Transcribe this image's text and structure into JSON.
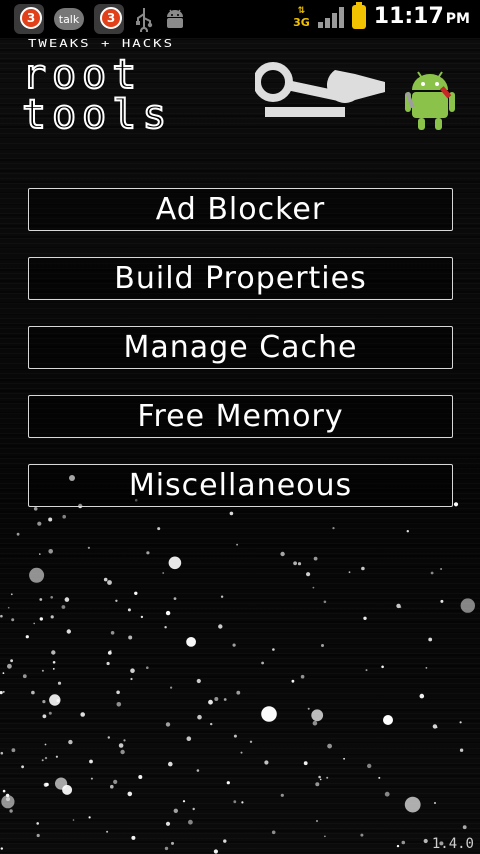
{
  "status_bar": {
    "notifications": [
      {
        "icon": "gmail-icon",
        "count": "3"
      },
      {
        "icon": "talk-icon",
        "label": "talk"
      },
      {
        "icon": "message-icon",
        "count": "3"
      },
      {
        "icon": "usb-icon"
      },
      {
        "icon": "android-debug-icon"
      }
    ],
    "network": "3G",
    "time": "11:17",
    "ampm": "PM",
    "colors": {
      "badge": "#e0401a",
      "battery": "#f2c200"
    }
  },
  "header": {
    "subtitle": "TWEAKS + HACKS",
    "title_line1": "root",
    "title_line2": "tools",
    "icons": [
      "wrench-icon",
      "android-mascot-icon"
    ]
  },
  "menu": {
    "items": [
      {
        "label": "Ad Blocker"
      },
      {
        "label": "Build Properties"
      },
      {
        "label": "Manage Cache"
      },
      {
        "label": "Free Memory"
      },
      {
        "label": "Miscellaneous"
      }
    ]
  },
  "footer": {
    "version": "1.4.0"
  }
}
